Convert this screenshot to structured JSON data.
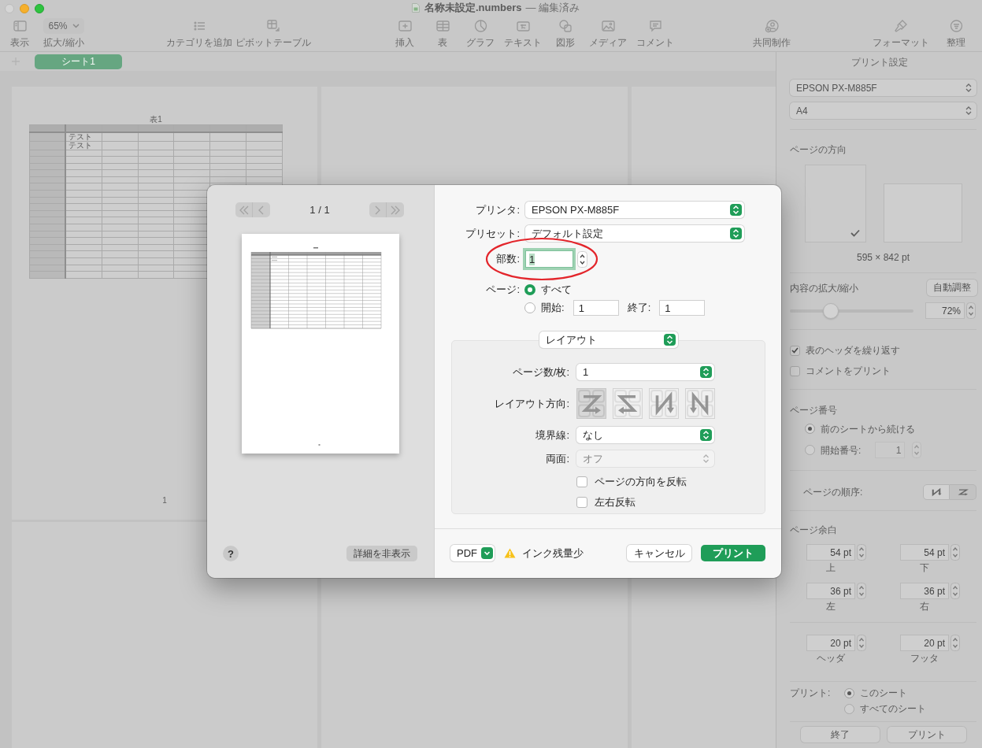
{
  "window": {
    "title": "名称未設定.numbers",
    "edited_label": "— 編集済み"
  },
  "toolbar": {
    "groups": [
      {
        "items": [
          {
            "kind": "button",
            "label": "表示"
          },
          {
            "kind": "dropdown",
            "label": "拡大/縮小",
            "value": "65%"
          }
        ]
      },
      {
        "items": [
          {
            "kind": "button",
            "label": "カテゴリを追加"
          },
          {
            "kind": "button",
            "label": "ピボットテーブル"
          }
        ]
      },
      {
        "items": [
          {
            "kind": "button",
            "label": "挿入"
          },
          {
            "kind": "button",
            "label": "表"
          },
          {
            "kind": "button",
            "label": "グラフ"
          },
          {
            "kind": "button",
            "label": "テキスト"
          },
          {
            "kind": "button",
            "label": "図形"
          },
          {
            "kind": "button",
            "label": "メディア"
          },
          {
            "kind": "button",
            "label": "コメント"
          }
        ]
      },
      {
        "items": [
          {
            "kind": "button",
            "label": "共同制作"
          }
        ]
      },
      {
        "items": [
          {
            "kind": "button",
            "label": "フォーマット"
          },
          {
            "kind": "button",
            "label": "整理"
          }
        ]
      }
    ]
  },
  "sheet_tabs": [
    {
      "label": "シート1",
      "selected": true
    }
  ],
  "canvas": {
    "pages": [
      {
        "kind": "table",
        "table": {
          "title": "表1",
          "rows": [
            {
              "cells": [
                "テスト"
              ]
            },
            {
              "cells": [
                "テスト"
              ]
            }
          ]
        },
        "page_number": "1"
      },
      {
        "kind": "blank"
      },
      {
        "kind": "blank"
      },
      {
        "kind": "blank"
      },
      {
        "kind": "blank"
      },
      {
        "kind": "blank"
      }
    ]
  },
  "print_settings": {
    "title": "プリント設定",
    "printer": "EPSON PX-M885F",
    "paper_size": "A4",
    "orientation": {
      "label": "ページの方向",
      "options": [
        {
          "kind": "portrait",
          "selected": true
        },
        {
          "kind": "landscape",
          "selected": false
        }
      ],
      "size": "595 × 842 pt"
    },
    "content_scale": {
      "label": "内容の拡大/縮小",
      "auto_button": "自動調整",
      "level": 0.33,
      "value": "72%"
    },
    "options": [
      {
        "label": "表のヘッダを繰り返す",
        "checked": true
      },
      {
        "label": "コメントをプリント",
        "checked": false
      }
    ],
    "page_numbers": {
      "label": "ページ番号",
      "choices": [
        {
          "label": "前のシートから続ける",
          "selected": true
        },
        {
          "label": "開始番号:",
          "selected": false,
          "value": "1",
          "disabled": true
        }
      ]
    },
    "page_order": {
      "label": "ページの順序:",
      "options": [
        {
          "kind": "reverse-n",
          "selected": true
        },
        {
          "kind": "z",
          "selected": false
        }
      ]
    },
    "margins": {
      "label": "ページ余白",
      "fields": [
        {
          "value": "54 pt",
          "caption": "上"
        },
        {
          "value": "54 pt",
          "caption": "下"
        },
        {
          "value": "36 pt",
          "caption": "左"
        },
        {
          "value": "36 pt",
          "caption": "右"
        }
      ]
    },
    "header_footer": [
      {
        "value": "20 pt",
        "caption": "ヘッダ"
      },
      {
        "value": "20 pt",
        "caption": "フッタ"
      }
    ],
    "print_scope": {
      "label": "プリント:",
      "choices": [
        {
          "label": "このシート",
          "selected": true
        },
        {
          "label": "すべてのシート",
          "selected": false
        }
      ]
    },
    "buttons": [
      "終了",
      "プリント"
    ]
  },
  "print_dialog": {
    "preview": {
      "page_indicator": "1 / 1",
      "navigation_disabled": true
    },
    "help_button": "?",
    "details_button": "詳細を非表示",
    "printer": {
      "label": "プリンタ:",
      "value": "EPSON PX-M885F"
    },
    "preset": {
      "label": "プリセット:",
      "value": "デフォルト設定"
    },
    "copies": {
      "label": "部数:",
      "value": "1",
      "focused": true,
      "circled": true
    },
    "pages": {
      "label": "ページ:",
      "choices": [
        {
          "label": "すべて",
          "selected": true
        },
        {
          "label": "開始:",
          "selected": false,
          "range": {
            "from": "1",
            "to_label": "終了:",
            "to": "1"
          }
        }
      ]
    },
    "section": {
      "value": "レイアウト"
    },
    "layout": {
      "pages_per_sheet": {
        "label": "ページ数/枚:",
        "value": "1"
      },
      "direction": {
        "label": "レイアウト方向:",
        "options": [
          {
            "kind": "z",
            "selected": true
          },
          {
            "kind": "reverse-z",
            "selected": false
          },
          {
            "kind": "reverse-n",
            "selected": false
          },
          {
            "kind": "n",
            "selected": false
          }
        ]
      },
      "border": {
        "label": "境界線:",
        "value": "なし"
      },
      "two_sided": {
        "label": "両面:",
        "value": "オフ",
        "disabled": true
      },
      "checkboxes": [
        {
          "label": "ページの方向を反転",
          "checked": false
        },
        {
          "label": "左右反転",
          "checked": false
        }
      ]
    },
    "pdf_button": "PDF",
    "warning": "インク残量少",
    "cancel_button": "キャンセル",
    "print_button": "プリント"
  }
}
